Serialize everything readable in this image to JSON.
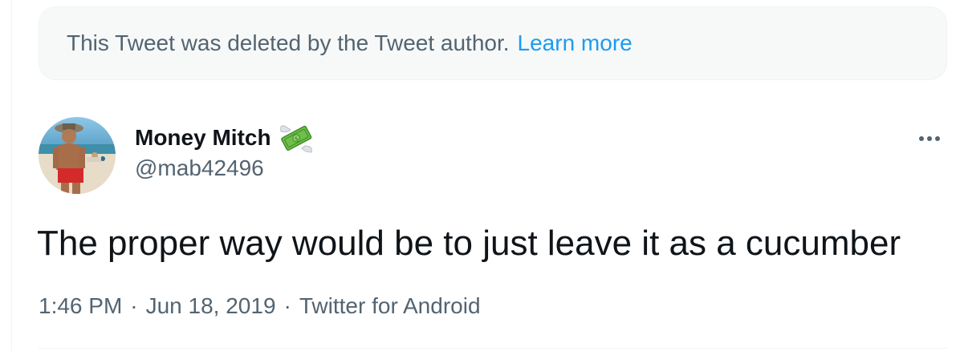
{
  "notice": {
    "text": "This Tweet was deleted by the Tweet author.",
    "link_label": "Learn more"
  },
  "author": {
    "display_name": "Money Mitch",
    "badge_icon": "money-with-wings-icon",
    "handle": "@mab42496"
  },
  "tweet": {
    "text": "The proper way would be to just leave it as a cucumber",
    "time": "1:46 PM",
    "date": "Jun 18, 2019",
    "source": "Twitter for Android",
    "separator": "·"
  },
  "colors": {
    "link": "#1d9bf0",
    "secondary_text": "#536471",
    "primary_text": "#0f1419"
  }
}
